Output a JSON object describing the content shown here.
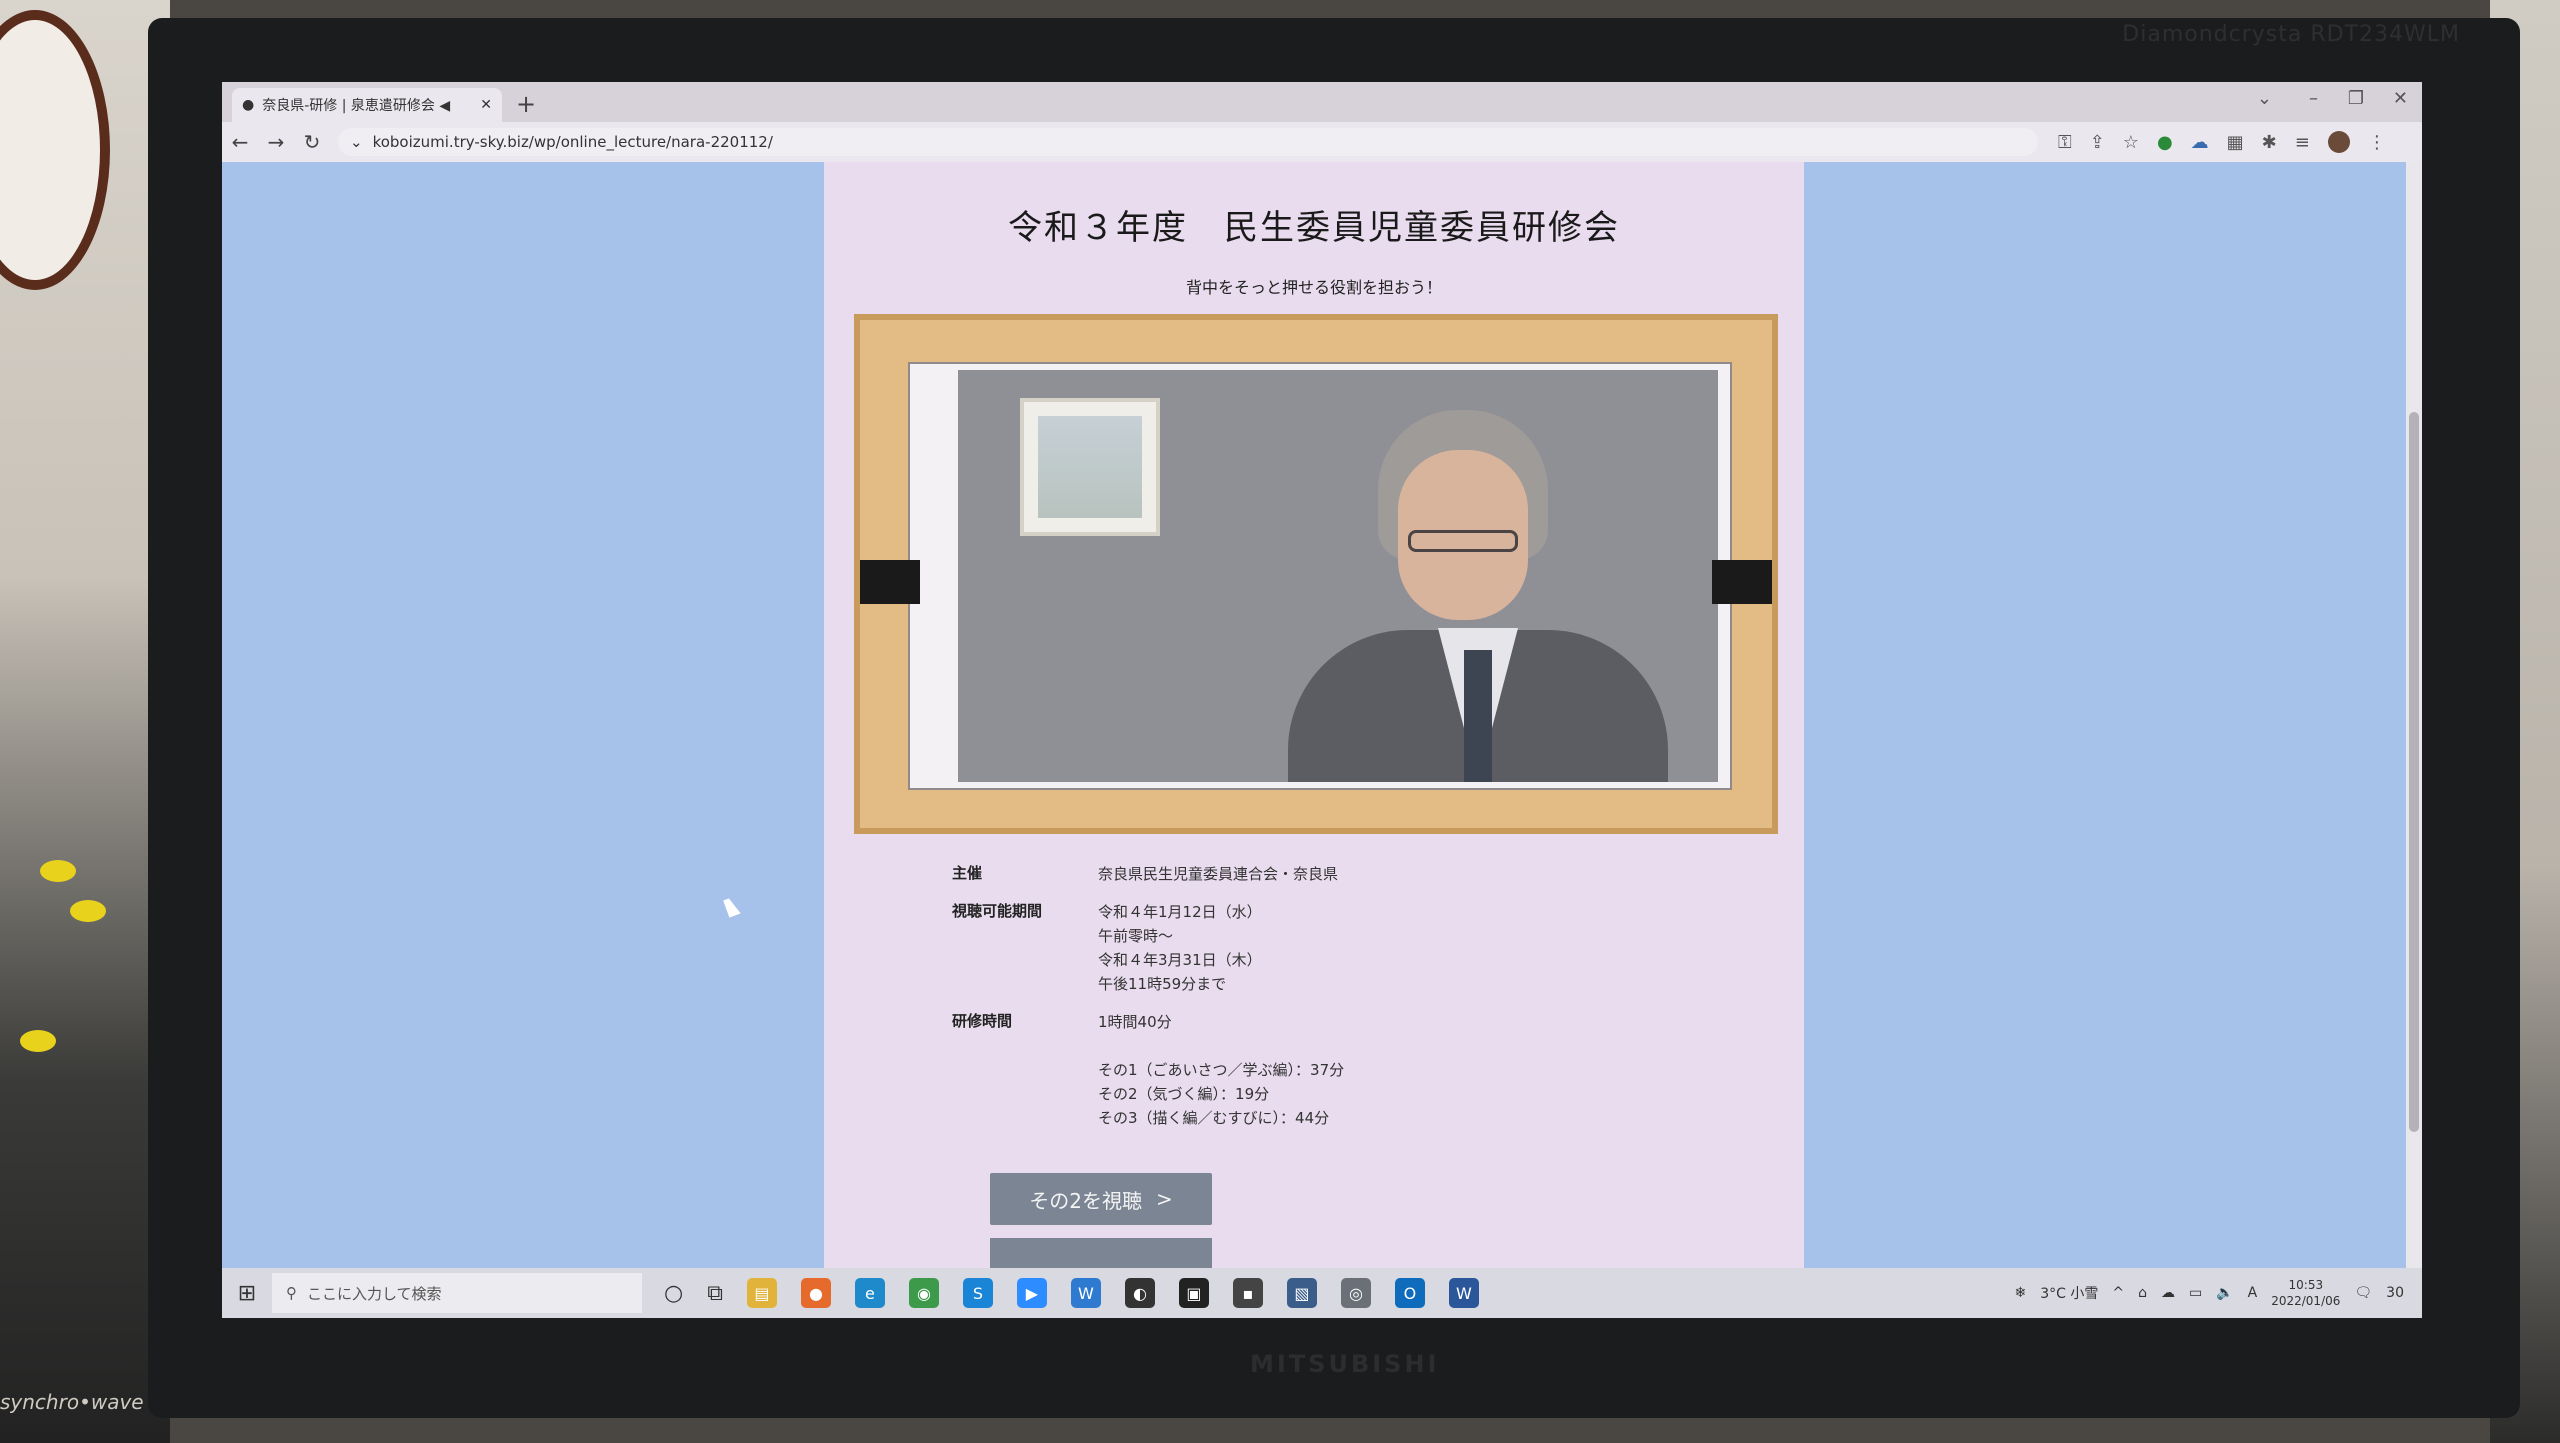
{
  "monitor": {
    "brand_top": "Diamondcrysta RDT234WLM",
    "brand_bottom": "MITSUBISHI",
    "speaker_label": "synchro•wave"
  },
  "browser": {
    "tab_title": "奈良県-研修 | 泉恵遣研修会 ◀",
    "new_tab": "+",
    "close_tab": "✕",
    "url": "koboizumi.try-sky.biz/wp/online_lecture/nara-220112/"
  },
  "page": {
    "title": "令和３年度　民生委員児童委員研修会",
    "subtitle": "背中をそっと押せる役割を担おう！",
    "info": [
      {
        "key": "主催",
        "values": [
          "奈良県民生児童委員連合会・奈良県"
        ]
      },
      {
        "key": "視聴可能期間",
        "values": [
          "令和４年1月12日（水）",
          "午前零時〜",
          "令和４年3月31日（木）",
          "午後11時59分まで"
        ]
      },
      {
        "key": "研修時間",
        "values": [
          "1時間40分",
          "",
          "その1（ごあいさつ／学ぶ編）：37分",
          "その2（気づく編）：19分",
          "その3（描く編／むすびに）：44分"
        ]
      }
    ],
    "watch_button": "その2を視聴",
    "watch_button_arrow": ">"
  },
  "taskbar": {
    "search_placeholder": "ここに入力して検索",
    "weather": "3°C 小雪",
    "time": "10:53",
    "date": "2022/01/06",
    "notification_count": "30",
    "ime": "A"
  }
}
